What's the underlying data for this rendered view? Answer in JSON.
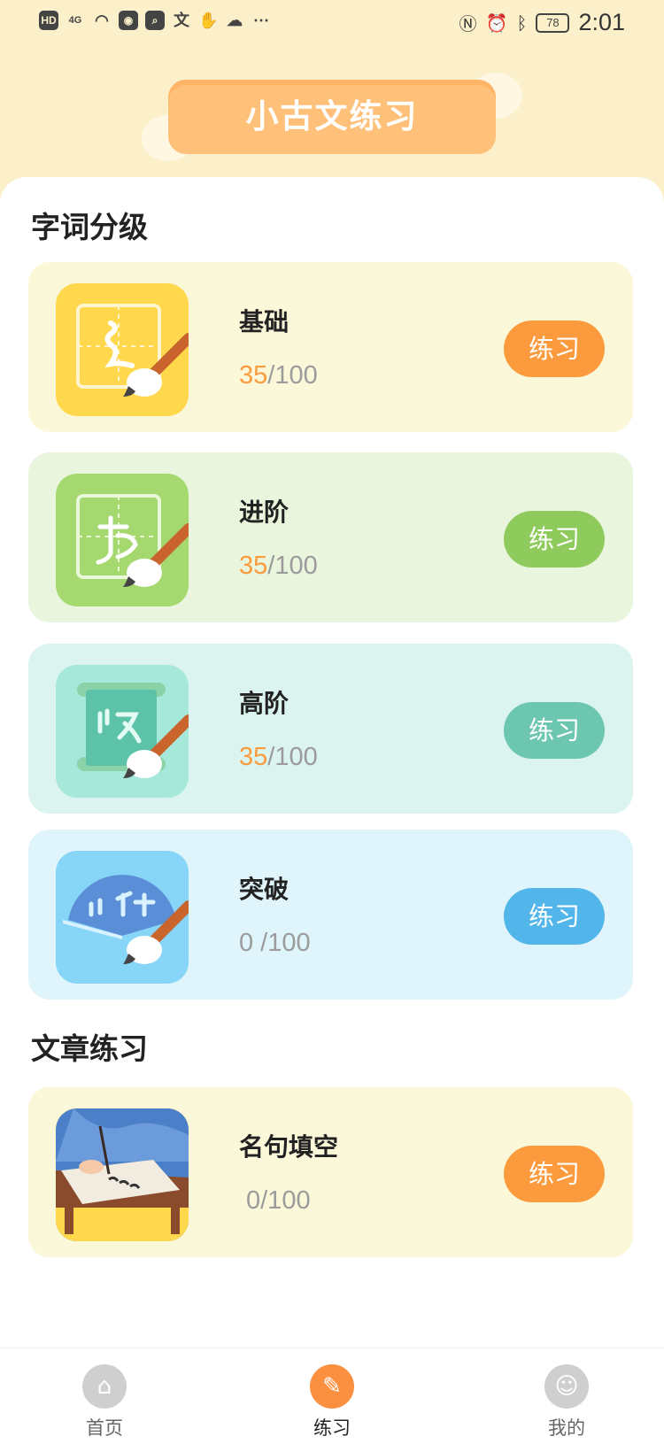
{
  "status_bar": {
    "network_label": "HD",
    "signal_label": "4G",
    "battery": "78",
    "time": "2:01"
  },
  "header": {
    "title": "小古文练习"
  },
  "sections": {
    "words_title": "字词分级",
    "articles_title": "文章练习"
  },
  "levels": [
    {
      "name": "基础",
      "done": "35",
      "total": "/100",
      "button": "练习",
      "color": "#fb9b3e"
    },
    {
      "name": "进阶",
      "done": "35",
      "total": "/100",
      "button": "练习",
      "color": "#8fcb5c"
    },
    {
      "name": "高阶",
      "done": "35",
      "total": "/100",
      "button": "练习",
      "color": "#6cc6b0"
    },
    {
      "name": "突破",
      "done": "",
      "total": "0 /100",
      "button": "练习",
      "color": "#52b6ea"
    }
  ],
  "articles": [
    {
      "name": "名句填空",
      "done": "",
      "total": "0/100",
      "button": "练习",
      "color": "#fb9b3e"
    }
  ],
  "tabbar": {
    "home": "首页",
    "practice": "练习",
    "mine": "我的"
  },
  "colors": {
    "background": "#fbf0c9",
    "accent": "#fb9040",
    "progress_done": "#fb9b3e"
  }
}
